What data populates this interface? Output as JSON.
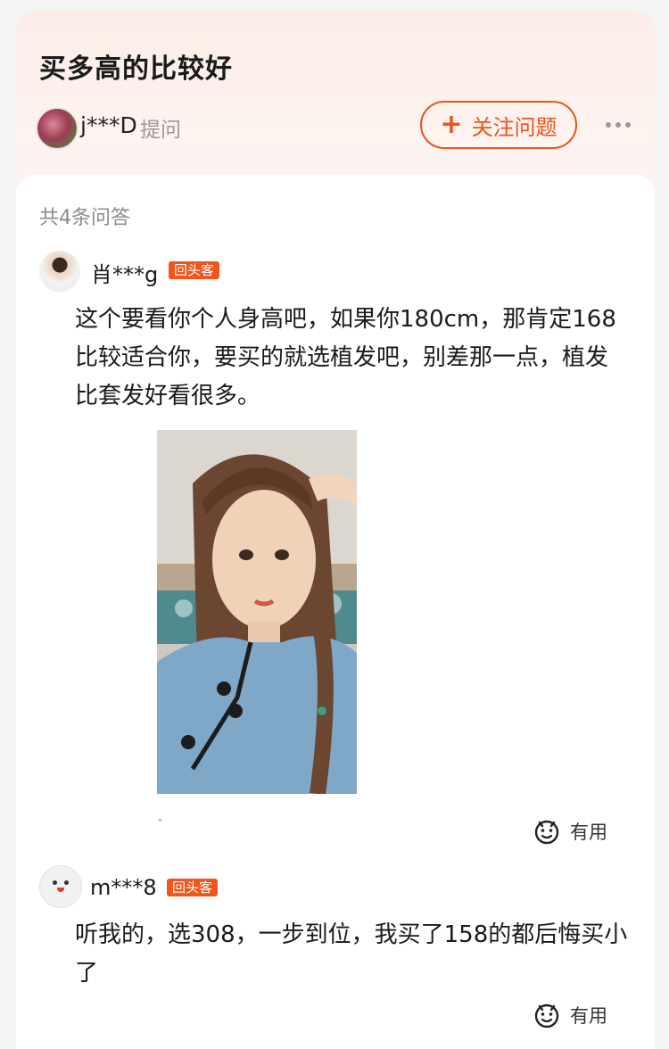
{
  "question": {
    "title": "买多高的比较好",
    "asker_name": "j***D",
    "asker_action": "提问",
    "follow_button": "关注问题",
    "more_icon": "more-dots-icon"
  },
  "answer_count": "共4条问答",
  "colors": {
    "accent": "#e8541c",
    "badge": "#f2541b",
    "header_bg": "#fbece6"
  },
  "answers": [
    {
      "user": "肖***g",
      "badge": "回头客",
      "text": "这个要看你个人身高吧，如果你180cm，那肯定168比较适合你，要买的就选植发吧，别差那一点，植发比套发好看很多。",
      "has_image": true,
      "useful_label": "有用"
    },
    {
      "user": "m***8",
      "badge": "回头客",
      "text": "听我的，选308，一步到位，我买了158的都后悔买小了",
      "has_image": false,
      "useful_label": "有用"
    }
  ]
}
